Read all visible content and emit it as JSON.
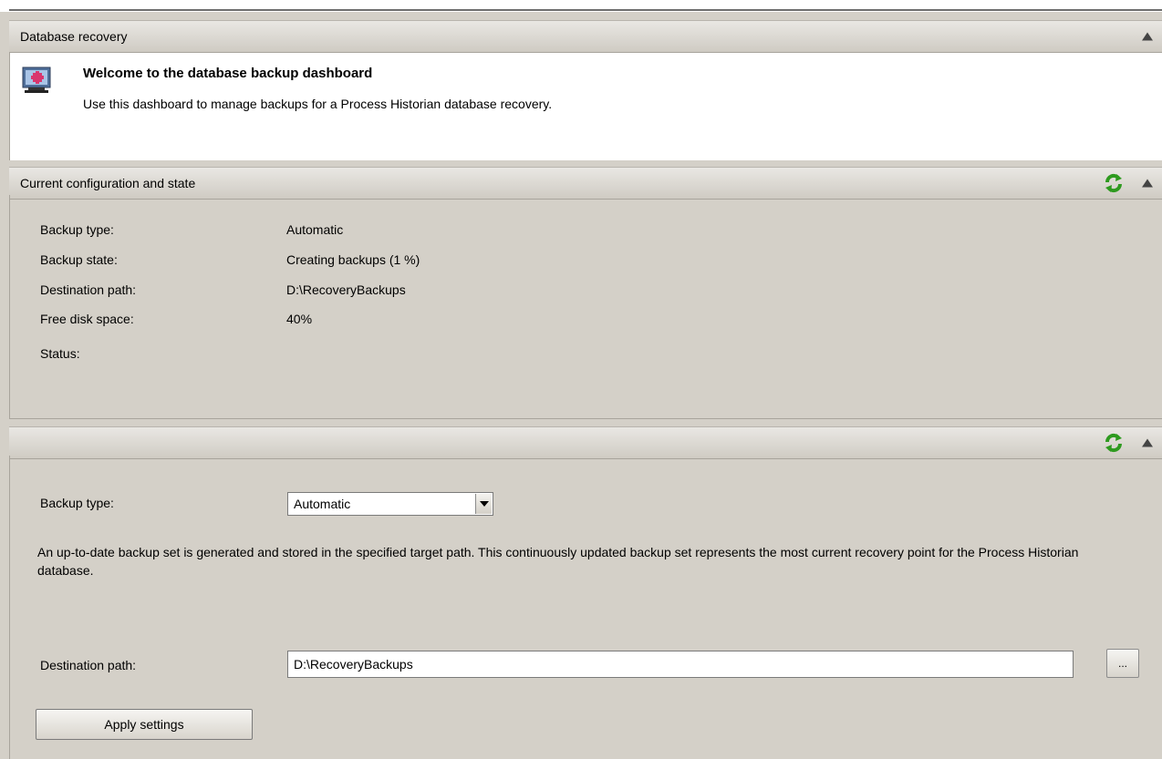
{
  "database_recovery": {
    "header_title": "Database recovery"
  },
  "welcome": {
    "title": "Welcome to the database backup dashboard",
    "description": "Use this dashboard to manage backups for a Process Historian database recovery."
  },
  "current_state": {
    "header_title": "Current configuration and state",
    "rows": [
      {
        "label": "Backup type:",
        "value": "Automatic"
      },
      {
        "label": "Backup state:",
        "value": "Creating backups (1 %)"
      },
      {
        "label": "Destination path:",
        "value": "D:\\RecoveryBackups"
      },
      {
        "label": "Free disk space:",
        "value": "40%"
      },
      {
        "label": "Status:",
        "value": ""
      }
    ]
  },
  "settings": {
    "backup_type_label": "Backup type:",
    "backup_type_value": "Automatic",
    "description": "An up-to-date backup set is generated and stored in the specified target path. This continuously updated backup set represents the most current recovery point for the Process Historian database.",
    "destination_label": "Destination path:",
    "destination_value": "D:\\RecoveryBackups",
    "browse_label": "...",
    "apply_label": "Apply settings"
  },
  "icons": {
    "refresh": "refresh-icon",
    "collapse": "collapse-arrow-icon",
    "welcome": "database-monitor-icon"
  },
  "colors": {
    "background": "#d4d0c8",
    "refresh_green": "#2e9a1f"
  }
}
